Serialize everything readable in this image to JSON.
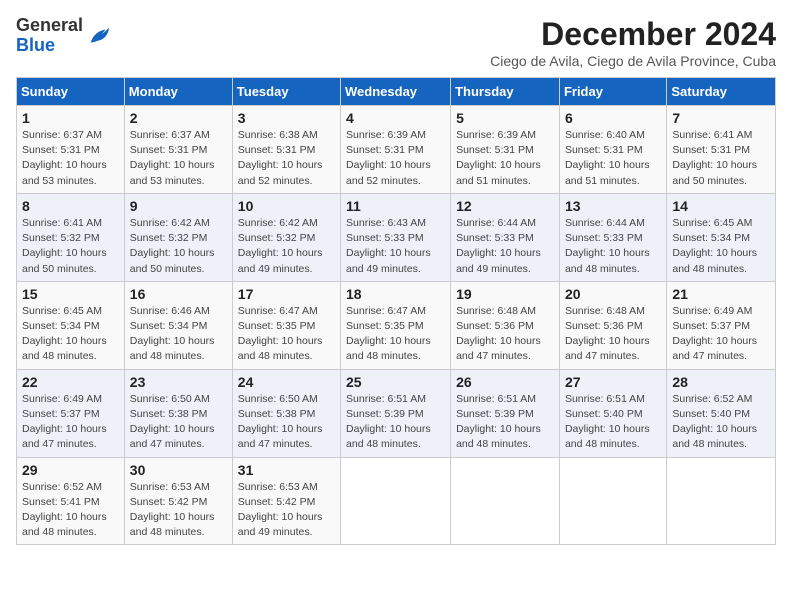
{
  "header": {
    "logo_general": "General",
    "logo_blue": "Blue",
    "month_title": "December 2024",
    "subtitle": "Ciego de Avila, Ciego de Avila Province, Cuba"
  },
  "weekdays": [
    "Sunday",
    "Monday",
    "Tuesday",
    "Wednesday",
    "Thursday",
    "Friday",
    "Saturday"
  ],
  "weeks": [
    [
      {
        "day": "1",
        "sunrise": "6:37 AM",
        "sunset": "5:31 PM",
        "daylight": "10 hours and 53 minutes."
      },
      {
        "day": "2",
        "sunrise": "6:37 AM",
        "sunset": "5:31 PM",
        "daylight": "10 hours and 53 minutes."
      },
      {
        "day": "3",
        "sunrise": "6:38 AM",
        "sunset": "5:31 PM",
        "daylight": "10 hours and 52 minutes."
      },
      {
        "day": "4",
        "sunrise": "6:39 AM",
        "sunset": "5:31 PM",
        "daylight": "10 hours and 52 minutes."
      },
      {
        "day": "5",
        "sunrise": "6:39 AM",
        "sunset": "5:31 PM",
        "daylight": "10 hours and 51 minutes."
      },
      {
        "day": "6",
        "sunrise": "6:40 AM",
        "sunset": "5:31 PM",
        "daylight": "10 hours and 51 minutes."
      },
      {
        "day": "7",
        "sunrise": "6:41 AM",
        "sunset": "5:31 PM",
        "daylight": "10 hours and 50 minutes."
      }
    ],
    [
      {
        "day": "8",
        "sunrise": "6:41 AM",
        "sunset": "5:32 PM",
        "daylight": "10 hours and 50 minutes."
      },
      {
        "day": "9",
        "sunrise": "6:42 AM",
        "sunset": "5:32 PM",
        "daylight": "10 hours and 50 minutes."
      },
      {
        "day": "10",
        "sunrise": "6:42 AM",
        "sunset": "5:32 PM",
        "daylight": "10 hours and 49 minutes."
      },
      {
        "day": "11",
        "sunrise": "6:43 AM",
        "sunset": "5:33 PM",
        "daylight": "10 hours and 49 minutes."
      },
      {
        "day": "12",
        "sunrise": "6:44 AM",
        "sunset": "5:33 PM",
        "daylight": "10 hours and 49 minutes."
      },
      {
        "day": "13",
        "sunrise": "6:44 AM",
        "sunset": "5:33 PM",
        "daylight": "10 hours and 48 minutes."
      },
      {
        "day": "14",
        "sunrise": "6:45 AM",
        "sunset": "5:34 PM",
        "daylight": "10 hours and 48 minutes."
      }
    ],
    [
      {
        "day": "15",
        "sunrise": "6:45 AM",
        "sunset": "5:34 PM",
        "daylight": "10 hours and 48 minutes."
      },
      {
        "day": "16",
        "sunrise": "6:46 AM",
        "sunset": "5:34 PM",
        "daylight": "10 hours and 48 minutes."
      },
      {
        "day": "17",
        "sunrise": "6:47 AM",
        "sunset": "5:35 PM",
        "daylight": "10 hours and 48 minutes."
      },
      {
        "day": "18",
        "sunrise": "6:47 AM",
        "sunset": "5:35 PM",
        "daylight": "10 hours and 48 minutes."
      },
      {
        "day": "19",
        "sunrise": "6:48 AM",
        "sunset": "5:36 PM",
        "daylight": "10 hours and 47 minutes."
      },
      {
        "day": "20",
        "sunrise": "6:48 AM",
        "sunset": "5:36 PM",
        "daylight": "10 hours and 47 minutes."
      },
      {
        "day": "21",
        "sunrise": "6:49 AM",
        "sunset": "5:37 PM",
        "daylight": "10 hours and 47 minutes."
      }
    ],
    [
      {
        "day": "22",
        "sunrise": "6:49 AM",
        "sunset": "5:37 PM",
        "daylight": "10 hours and 47 minutes."
      },
      {
        "day": "23",
        "sunrise": "6:50 AM",
        "sunset": "5:38 PM",
        "daylight": "10 hours and 47 minutes."
      },
      {
        "day": "24",
        "sunrise": "6:50 AM",
        "sunset": "5:38 PM",
        "daylight": "10 hours and 47 minutes."
      },
      {
        "day": "25",
        "sunrise": "6:51 AM",
        "sunset": "5:39 PM",
        "daylight": "10 hours and 48 minutes."
      },
      {
        "day": "26",
        "sunrise": "6:51 AM",
        "sunset": "5:39 PM",
        "daylight": "10 hours and 48 minutes."
      },
      {
        "day": "27",
        "sunrise": "6:51 AM",
        "sunset": "5:40 PM",
        "daylight": "10 hours and 48 minutes."
      },
      {
        "day": "28",
        "sunrise": "6:52 AM",
        "sunset": "5:40 PM",
        "daylight": "10 hours and 48 minutes."
      }
    ],
    [
      {
        "day": "29",
        "sunrise": "6:52 AM",
        "sunset": "5:41 PM",
        "daylight": "10 hours and 48 minutes."
      },
      {
        "day": "30",
        "sunrise": "6:53 AM",
        "sunset": "5:42 PM",
        "daylight": "10 hours and 48 minutes."
      },
      {
        "day": "31",
        "sunrise": "6:53 AM",
        "sunset": "5:42 PM",
        "daylight": "10 hours and 49 minutes."
      },
      null,
      null,
      null,
      null
    ]
  ]
}
